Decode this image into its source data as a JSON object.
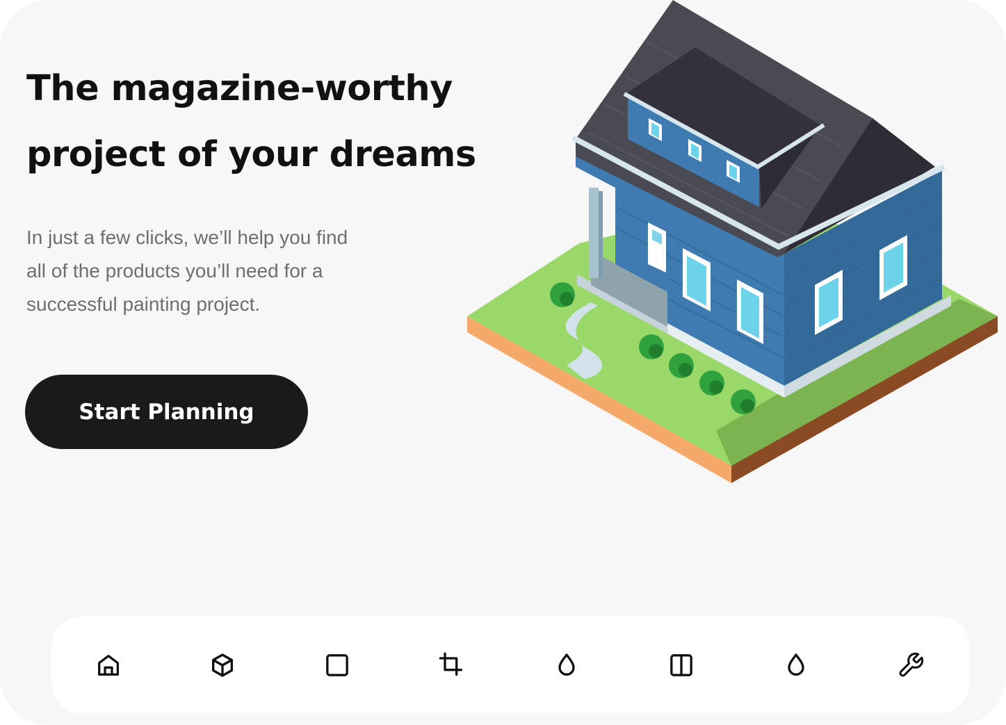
{
  "hero": {
    "headline": "The magazine-worthy\nproject of your dreams",
    "subtext": "In just a few clicks, we’ll help you find\nall of the products you’ll need for a\nsuccessful painting project.",
    "cta_label": "Start Planning"
  },
  "illustration": {
    "name": "isometric-house-illustration"
  },
  "nav": {
    "items": [
      {
        "icon": "home-icon"
      },
      {
        "icon": "cube-icon"
      },
      {
        "icon": "square-icon"
      },
      {
        "icon": "crop-icon"
      },
      {
        "icon": "drop-icon"
      },
      {
        "icon": "columns-icon"
      },
      {
        "icon": "drop-icon"
      },
      {
        "icon": "wrench-icon"
      }
    ]
  },
  "colors": {
    "background": "#f7f7f7",
    "cta_background": "#1a1a1a",
    "cta_text": "#ffffff",
    "headline": "#111111",
    "subtext": "#6e6e6e",
    "house_wall": "#3f7bb0",
    "roof": "#3a3a40",
    "grass": "#9bd86a"
  }
}
